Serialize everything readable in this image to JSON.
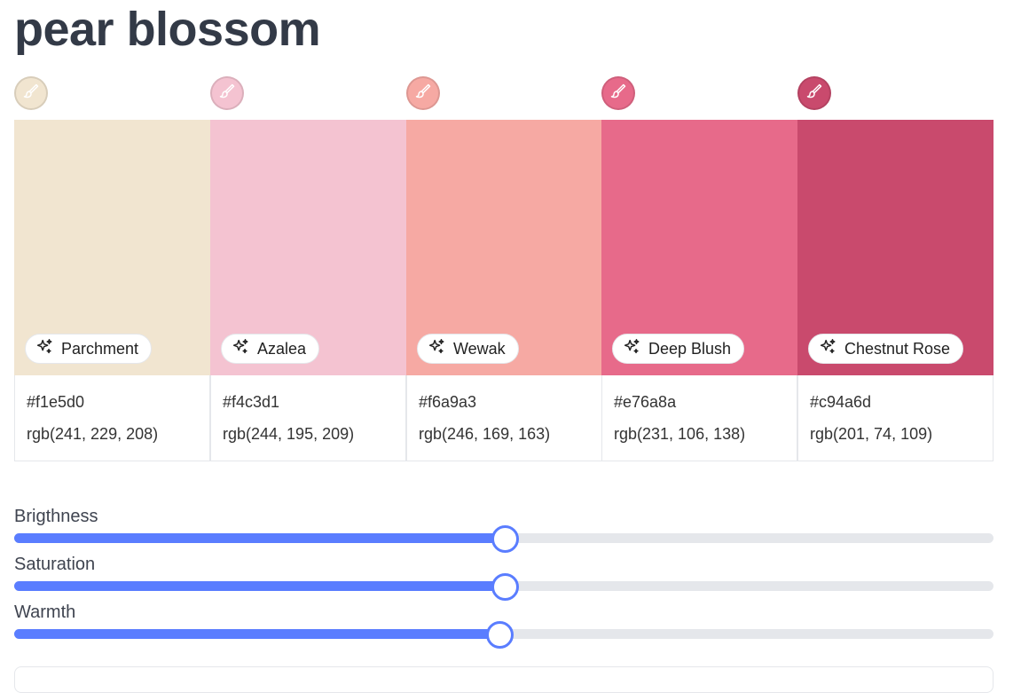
{
  "page": {
    "title": "pear blossom"
  },
  "colors": [
    {
      "name": "Parchment",
      "hex": "#f1e5d0",
      "rgb": "rgb(241, 229, 208)",
      "icon": "paintbrush-icon"
    },
    {
      "name": "Azalea",
      "hex": "#f4c3d1",
      "rgb": "rgb(244, 195, 209)",
      "icon": "paintbrush-icon"
    },
    {
      "name": "Wewak",
      "hex": "#f6a9a3",
      "rgb": "rgb(246, 169, 163)",
      "icon": "paintbrush-icon"
    },
    {
      "name": "Deep Blush",
      "hex": "#e76a8a",
      "rgb": "rgb(231, 106, 138)",
      "icon": "paintbrush-icon"
    },
    {
      "name": "Chestnut Rose",
      "hex": "#c94a6d",
      "rgb": "rgb(201, 74, 109)",
      "icon": "paintbrush-icon"
    }
  ],
  "sliders": [
    {
      "label": "Brigthness",
      "value": 0.5
    },
    {
      "label": "Saturation",
      "value": 0.5
    },
    {
      "label": "Warmth",
      "value": 0.495
    }
  ],
  "accent_color": "#5a7dff",
  "chip_icon": "sparkles-icon"
}
